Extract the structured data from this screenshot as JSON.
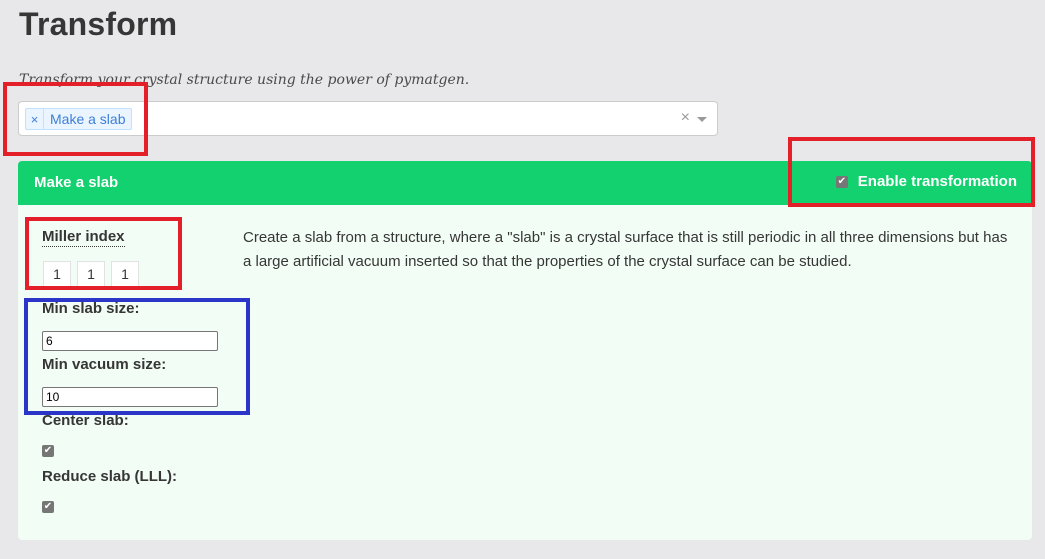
{
  "page": {
    "title": "Transform",
    "subtitle": "Transform your crystal structure using the power of pymatgen."
  },
  "selector": {
    "selected_tag": "Make a slab",
    "tag_remove": "×",
    "clear": "×"
  },
  "card": {
    "title": "Make a slab",
    "enable_label": "Enable transformation",
    "enable_checked": true,
    "description": "Create a slab from a structure, where a \"slab\" is a crystal surface that is still periodic in all three dimensions but has a large artificial vacuum inserted so that the properties of the crystal surface can be studied."
  },
  "form": {
    "miller_label": "Miller index",
    "miller": [
      "1",
      "1",
      "1"
    ],
    "min_slab_label": "Min slab size:",
    "min_slab_value": "6",
    "min_vacuum_label": "Min vacuum size:",
    "min_vacuum_value": "10",
    "center_slab_label": "Center slab:",
    "center_slab_checked": true,
    "reduce_slab_label": "Reduce slab (LLL):",
    "reduce_slab_checked": true
  },
  "colors": {
    "header_green": "#12d16e",
    "body_bg": "#f2fdf5",
    "annotation_red": "#e3202a",
    "annotation_blue": "#2b35c7"
  }
}
